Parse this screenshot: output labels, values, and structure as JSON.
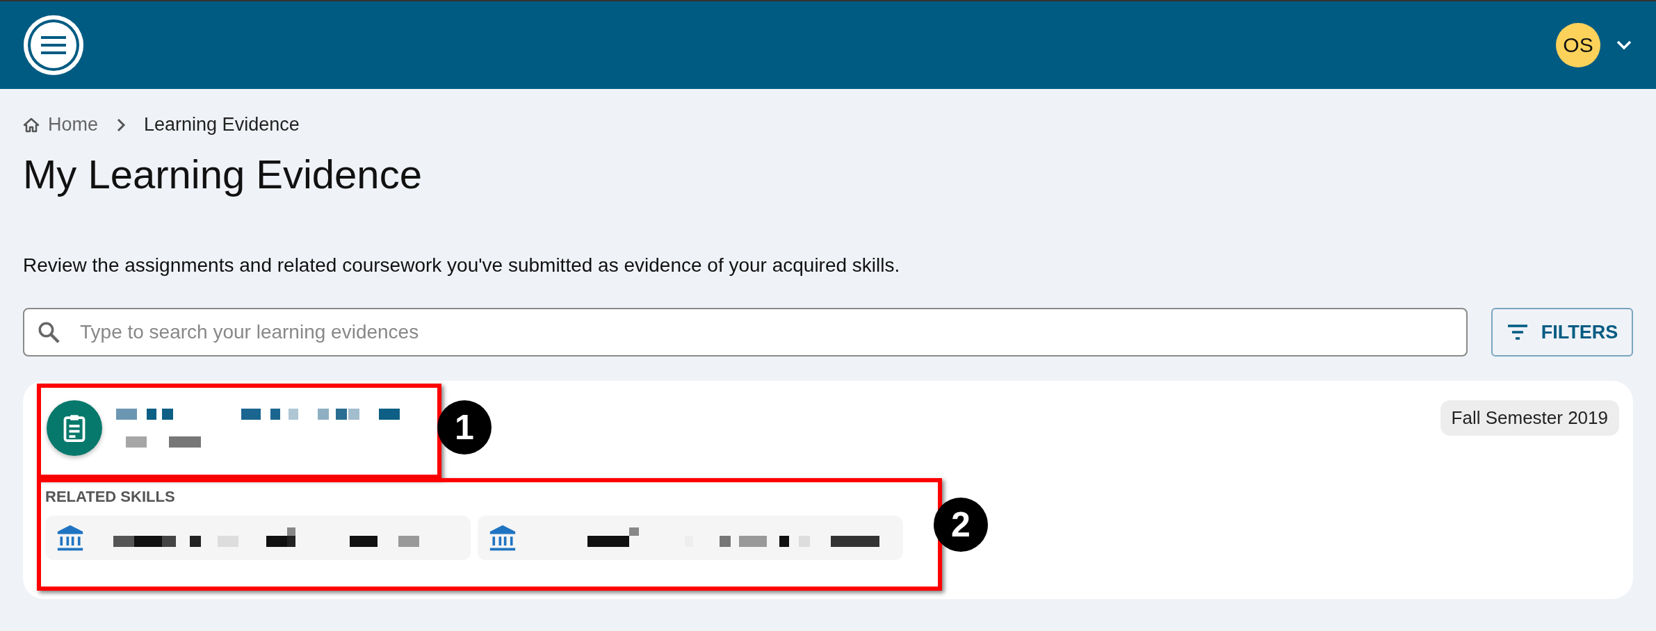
{
  "header": {
    "avatar": "OS"
  },
  "breadcrumbs": [
    {
      "label": "Home",
      "kind": "home"
    },
    {
      "label": "Learning Evidence",
      "kind": "current"
    }
  ],
  "title": "My Learning Evidence",
  "description": "Review the assignments and related coursework you've submitted as evidence of your acquired skills.",
  "search": {
    "placeholder": "Type to search your learning evidences"
  },
  "filters_button": "FILTERS",
  "evidence": [
    {
      "term": "Fall Semester 2019",
      "related_label": "RELATED SKILLS",
      "skills": [
        {
          "kind": "institution"
        },
        {
          "kind": "institution"
        }
      ]
    }
  ],
  "annotations": [
    "1",
    "2"
  ]
}
